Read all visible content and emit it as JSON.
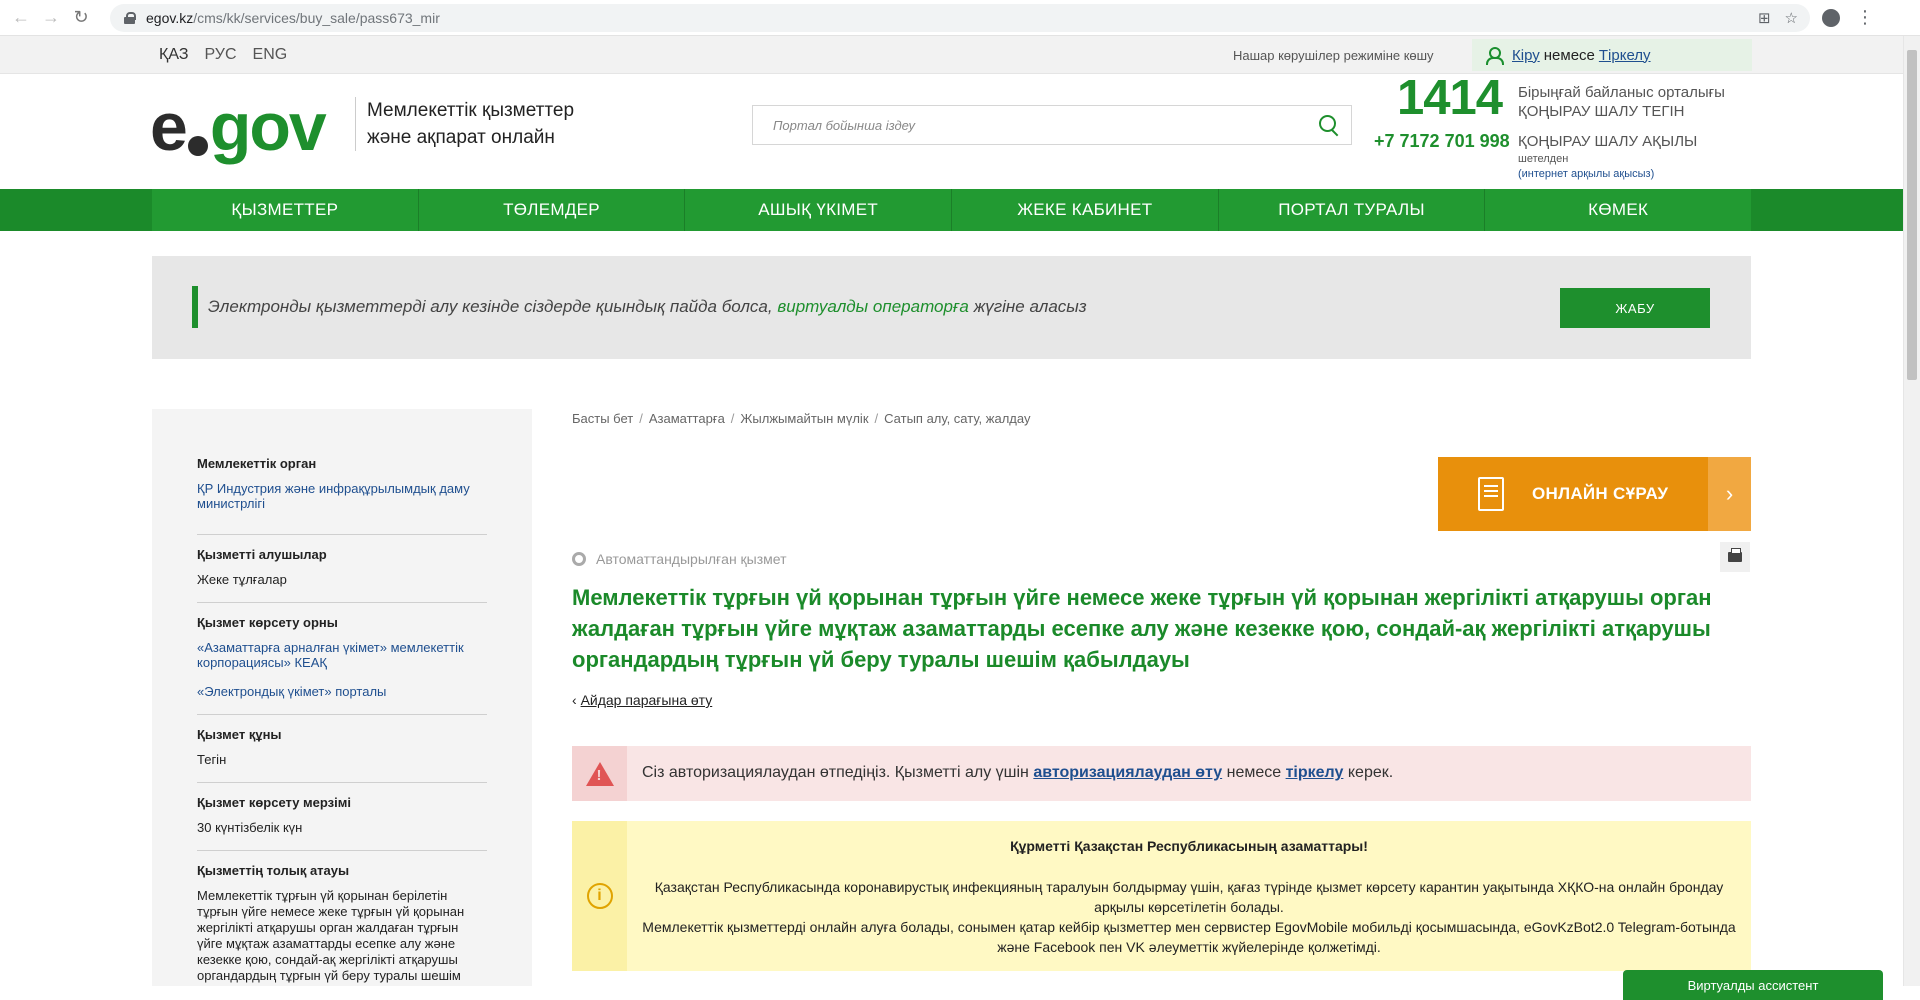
{
  "browser": {
    "url_host": "egov.kz",
    "url_path": "/cms/kk/services/buy_sale/pass673_mir"
  },
  "topbar": {
    "languages": [
      "ҚАЗ",
      "РУС",
      "ENG"
    ],
    "vision_mode": "Нашар көрушілер режиміне көшу",
    "login": "Кіру",
    "or": "немесе",
    "register": "Тіркелу"
  },
  "header": {
    "logo_e": "e",
    "logo_gov": "gov",
    "tagline_line1": "Мемлекеттік қызметтер",
    "tagline_line2": "және ақпарат онлайн",
    "search_placeholder": "Портал бойынша іздеу",
    "phone_short": "1414",
    "phone_short_desc1": "Бірыңғай байланыс орталығы",
    "phone_short_desc2": "ҚОҢЫРАУ ШАЛУ ТЕГІН",
    "phone_long": "+7 7172 701 998",
    "phone_long_desc": "ҚОҢЫРАУ ШАЛУ АҚЫЛЫ",
    "abroad": "шетелден",
    "abroad_note": "(интернет арқылы ақысыз)"
  },
  "nav": {
    "items": [
      "ҚЫЗМЕТТЕР",
      "ТӨЛЕМДЕР",
      "АШЫҚ ҮКІМЕТ",
      "ЖЕКЕ КАБИНЕТ",
      "ПОРТАЛ ТУРАЛЫ",
      "КӨМЕК"
    ]
  },
  "banner": {
    "text_before": "Электронды қызметтерді алу кезінде сіздерде қиындық пайда болса,",
    "link": "виртуалды операторға",
    "text_after": "жүгіне аласыз",
    "close": "ЖАБУ"
  },
  "sidebar": {
    "agency_title": "Мемлекеттік орган",
    "agency": "ҚР Индустрия және инфрақұрылымдық даму министрлігі",
    "recipients_title": "Қызметті алушылар",
    "recipients": "Жеке тұлғалар",
    "place_title": "Қызмет көрсету орны",
    "place1": "«Азаматтарға арналған үкімет» мемлекеттік корпорациясы» КЕАҚ",
    "place2": "«Электрондық үкімет» порталы",
    "cost_title": "Қызмет құны",
    "cost": "Тегін",
    "term_title": "Қызмет көрсету мерзімі",
    "term": "30 күнтізбелік күн",
    "fullname_title": "Қызметтің толық атауы",
    "fullname": "Мемлекеттік тұрғын үй қорынан берілетін тұрғын үйге немесе жеке тұрғын үй қорынан жергілікті атқарушы орган жалдаған тұрғын үйге мұқтаж азаматтарды есепке алу және кезекке қою, сондай-ақ жергілікті атқарушы органдардың тұрғын үй беру туралы шешім"
  },
  "main": {
    "breadcrumbs": [
      "Басты бет",
      "Азаматтарға",
      "Жылжымайтын мүлік",
      "Сатып алу, сату, жалдау"
    ],
    "online_request": "ОНЛАЙН СҰРАУ",
    "auto_label": "Автоматтандырылған қызмет",
    "title": "Мемлекеттік тұрғын үй қорынан тұрғын үйге немесе жеке тұрғын үй қорынан жергілікті атқарушы орган жалдаған тұрғын үйге мұқтаж азаматтарды есепке алу және кезекке қою, сондай-ақ жергілікті атқарушы органдардың тұрғын үй беру туралы шешім қабылдауы",
    "back_link": "Айдар парағына өту",
    "alert_before": "Сіз авторизациялаудан өтпедіңіз. Қызметті алу үшін",
    "alert_link": "авторизациялаудан өту",
    "alert_or": "немесе",
    "alert_register": "тіркелу",
    "alert_after": "керек.",
    "notice_title": "Құрметті Қазақстан Республикасының азаматтары!",
    "notice_body1": "Қазақстан Республикасында коронавирустық инфекцияның таралуын болдырмау үшін, қағаз түрінде қызмет көрсету карантин уақытында ХҚКО-на онлайн брондау арқылы көрсетілетін болады.",
    "notice_body2": "Мемлекеттік қызметтерді онлайн алуға болады, сонымен қатар кейбір қызметтер мен сервистер EgovMobile мобильді қосымшасында, eGovKzBot2.0 Telegram-ботында және Facebook пен VK әлеуметтік жүйелерінде қолжетімді.",
    "virtual_assistant": "Виртуалды ассистент"
  }
}
